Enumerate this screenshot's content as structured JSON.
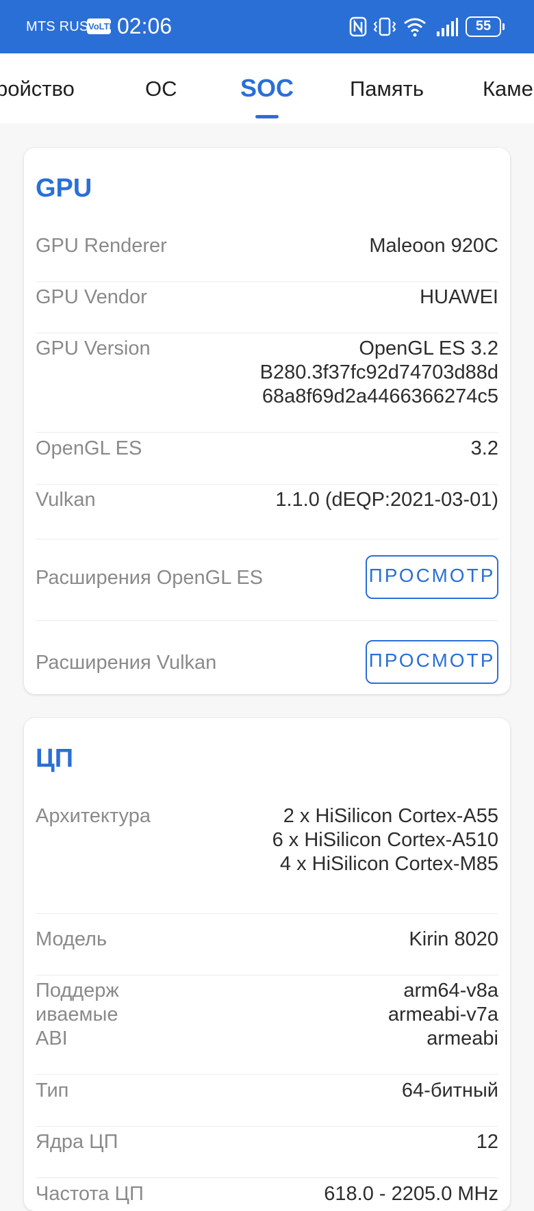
{
  "status_bar": {
    "carrier": "MTS RUS",
    "volte": "VoLTE",
    "time": "02:06",
    "battery": "55",
    "icons": [
      "nfc-icon",
      "vibrate-icon",
      "wifi-icon",
      "signal-icon",
      "battery-icon"
    ]
  },
  "tabs": [
    "ройство",
    "ОС",
    "SOC",
    "Память",
    "Каме"
  ],
  "active_tab": "SOC",
  "gpu": {
    "title": "GPU",
    "rows": [
      {
        "label": "GPU Renderer",
        "value": "Maleoon 920C"
      },
      {
        "label": "GPU Vendor",
        "value": "HUAWEI"
      },
      {
        "label": "GPU Version",
        "value": "OpenGL ES 3.2\nB280.3f37fc92d74703d88d\n68a8f69d2a4466366274c5"
      },
      {
        "label": "OpenGL ES",
        "value": "3.2"
      },
      {
        "label": "Vulkan",
        "value": "1.1.0 (dEQP:2021-03-01)"
      }
    ],
    "ext_opengl_label": "Расширения OpenGL ES",
    "ext_vulkan_label": "Расширения Vulkan",
    "view_button": "ПРОСМОТР"
  },
  "cpu": {
    "title": "ЦП",
    "rows": [
      {
        "label": "Архитектура",
        "value": "2 x HiSilicon Cortex-A55\n6 x HiSilicon Cortex-A510\n4 x HiSilicon Cortex-M85"
      },
      {
        "label": "Модель",
        "value": "Kirin 8020"
      },
      {
        "label": "Поддерж\nиваемые\nABI",
        "value": "arm64-v8a\narmeabi-v7a\narmeabi"
      },
      {
        "label": "Тип",
        "value": "64-битный"
      },
      {
        "label": "Ядра ЦП",
        "value": "12"
      },
      {
        "label": "Частота ЦП",
        "value": "618.0 - 2205.0 MHz"
      }
    ]
  },
  "colors": {
    "accent": "#2a6fd6",
    "label": "#8a8a8a",
    "value": "#2d2d2d"
  }
}
